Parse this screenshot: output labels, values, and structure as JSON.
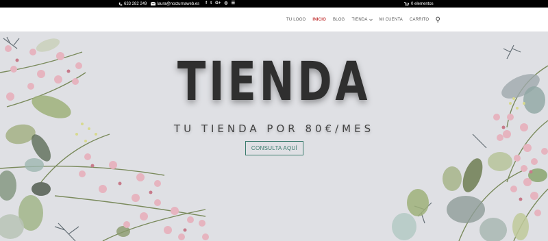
{
  "topbar": {
    "phone": "633 282 249",
    "email": "laura@nocturnaweb.es",
    "social": [
      {
        "icon": "facebook-icon",
        "glyph": "f"
      },
      {
        "icon": "twitter-icon",
        "glyph": "t"
      },
      {
        "icon": "google-plus-icon",
        "glyph": "G+"
      },
      {
        "icon": "instagram-icon",
        "glyph": "◎"
      },
      {
        "icon": "rss-icon",
        "glyph": "☰"
      }
    ],
    "cart_text": "0 elementos"
  },
  "nav": {
    "items": [
      {
        "label": "TU LOGO"
      },
      {
        "label": "INICIO"
      },
      {
        "label": "BLOG"
      },
      {
        "label": "TIENDA"
      },
      {
        "label": "MI CUENTA"
      },
      {
        "label": "CARRITO"
      }
    ]
  },
  "hero": {
    "title": "TIENDA",
    "subtitle": "TU TIENDA POR 80€/MES",
    "cta_label": "CONSULTA AQUÍ"
  },
  "colors": {
    "accent_active": "#c23232",
    "cta": "#3a7a6c",
    "background": "#dfe0e4"
  }
}
